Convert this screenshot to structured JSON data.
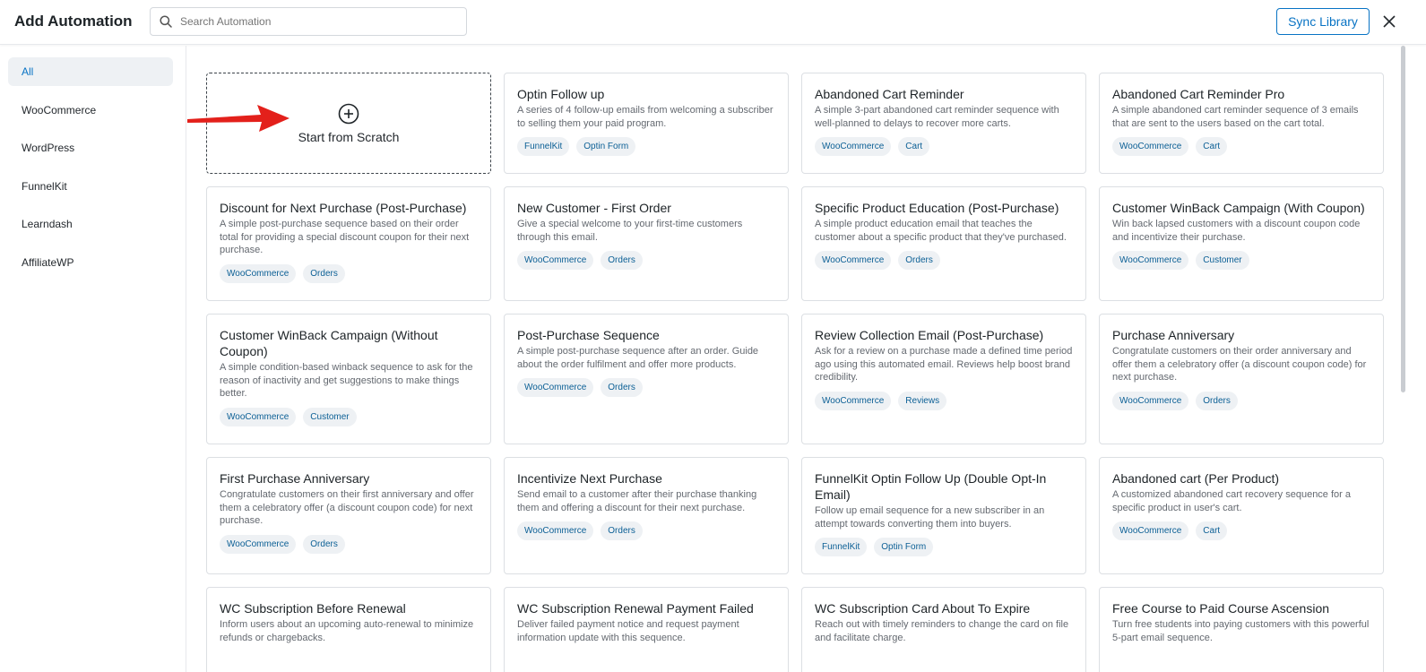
{
  "header": {
    "title": "Add Automation",
    "search_placeholder": "Search Automation",
    "sync_label": "Sync Library"
  },
  "sidebar": {
    "items": [
      {
        "label": "All",
        "active": true
      },
      {
        "label": "WooCommerce"
      },
      {
        "label": "WordPress"
      },
      {
        "label": "FunnelKit"
      },
      {
        "label": "Learndash"
      },
      {
        "label": "AffiliateWP"
      }
    ]
  },
  "scratch": {
    "label": "Start from Scratch"
  },
  "cards": [
    {
      "title": "Optin Follow up",
      "desc": "A series of 4 follow-up emails from welcoming a subscriber to selling them your paid program.",
      "tags": [
        "FunnelKit",
        "Optin Form"
      ]
    },
    {
      "title": "Abandoned Cart Reminder",
      "desc": "A simple 3-part abandoned cart reminder sequence with well-planned to delays to recover more carts.",
      "tags": [
        "WooCommerce",
        "Cart"
      ]
    },
    {
      "title": "Abandoned Cart Reminder Pro",
      "desc": "A simple abandoned cart reminder sequence of 3 emails that are sent to the users based on the cart total.",
      "tags": [
        "WooCommerce",
        "Cart"
      ]
    },
    {
      "title": "Discount for Next Purchase (Post-Purchase)",
      "desc": "A simple post-purchase sequence based on their order total for providing a special discount coupon for their next purchase.",
      "tags": [
        "WooCommerce",
        "Orders"
      ]
    },
    {
      "title": "New Customer - First Order",
      "desc": "Give a special welcome to your first-time customers through this email.",
      "tags": [
        "WooCommerce",
        "Orders"
      ]
    },
    {
      "title": "Specific Product Education (Post-Purchase)",
      "desc": "A simple product education email that teaches the customer about a specific product that they've purchased.",
      "tags": [
        "WooCommerce",
        "Orders"
      ]
    },
    {
      "title": "Customer WinBack Campaign (With Coupon)",
      "desc": "Win back lapsed customers with a discount coupon code and incentivize their purchase.",
      "tags": [
        "WooCommerce",
        "Customer"
      ]
    },
    {
      "title": "Customer WinBack Campaign (Without Coupon)",
      "desc": "A simple condition-based winback sequence to ask for the reason of inactivity and get suggestions to make things better.",
      "tags": [
        "WooCommerce",
        "Customer"
      ]
    },
    {
      "title": "Post-Purchase Sequence",
      "desc": "A simple post-purchase sequence after an order. Guide about the order fulfilment and offer more products.",
      "tags": [
        "WooCommerce",
        "Orders"
      ]
    },
    {
      "title": "Review Collection Email (Post-Purchase)",
      "desc": "Ask for a review on a purchase made a defined time period ago using this automated email. Reviews help boost brand credibility.",
      "tags": [
        "WooCommerce",
        "Reviews"
      ]
    },
    {
      "title": "Purchase Anniversary",
      "desc": "Congratulate customers on their order anniversary and offer them a celebratory offer (a discount coupon code) for next purchase.",
      "tags": [
        "WooCommerce",
        "Orders"
      ]
    },
    {
      "title": "First Purchase Anniversary",
      "desc": "Congratulate customers on their first anniversary and offer them a celebratory offer (a discount coupon code) for next purchase.",
      "tags": [
        "WooCommerce",
        "Orders"
      ]
    },
    {
      "title": "Incentivize Next Purchase",
      "desc": "Send email to a customer after their purchase thanking them and offering a discount for their next purchase.",
      "tags": [
        "WooCommerce",
        "Orders"
      ]
    },
    {
      "title": "FunnelKit Optin Follow Up (Double Opt-In Email)",
      "desc": "Follow up email sequence for a new subscriber in an attempt towards converting them into buyers.",
      "tags": [
        "FunnelKit",
        "Optin Form"
      ]
    },
    {
      "title": "Abandoned cart (Per Product)",
      "desc": "A customized abandoned cart recovery sequence for a specific product in user's cart.",
      "tags": [
        "WooCommerce",
        "Cart"
      ]
    },
    {
      "title": "WC Subscription Before Renewal",
      "desc": "Inform users about an upcoming auto-renewal to minimize refunds or chargebacks.",
      "tags": []
    },
    {
      "title": "WC Subscription Renewal Payment Failed",
      "desc": "Deliver failed payment notice and request payment information update with this sequence.",
      "tags": []
    },
    {
      "title": "WC Subscription Card About To Expire",
      "desc": "Reach out with timely reminders to change the card on file and facilitate charge.",
      "tags": []
    },
    {
      "title": "Free Course to Paid Course Ascension",
      "desc": "Turn free students into paying customers with this powerful 5-part email sequence.",
      "tags": []
    }
  ]
}
